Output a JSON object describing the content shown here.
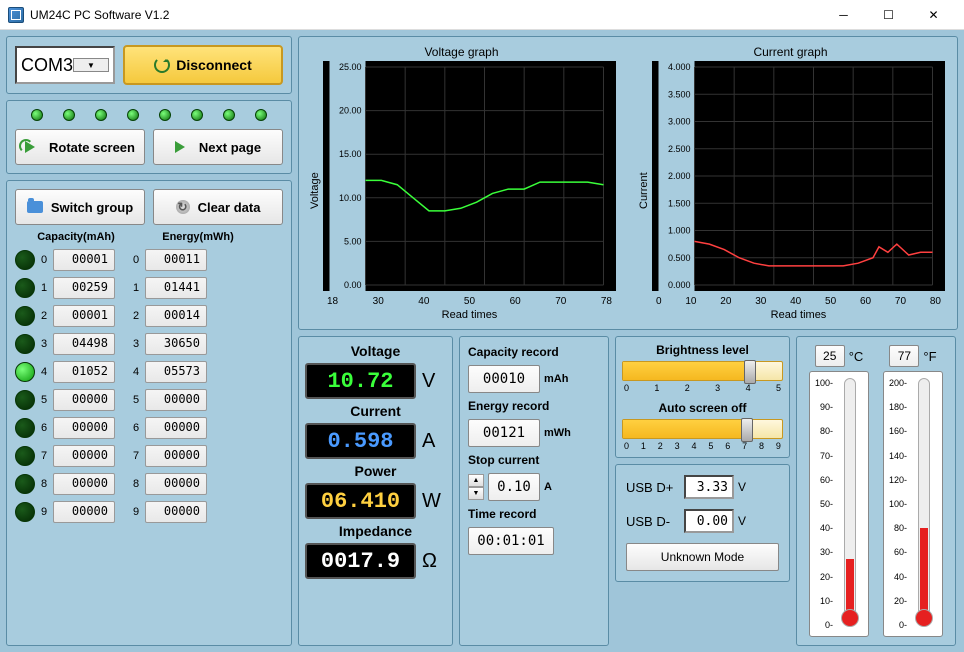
{
  "window": {
    "title": "UM24C PC Software V1.2"
  },
  "connection": {
    "port": "COM3",
    "button": "Disconnect"
  },
  "nav": {
    "rotate": "Rotate screen",
    "next": "Next page",
    "switch": "Switch group",
    "clear": "Clear data"
  },
  "groups": {
    "cap_header": "Capacity(mAh)",
    "en_header": "Energy(mWh)",
    "rows": [
      {
        "i": "0",
        "cap": "00001",
        "en": "00011",
        "on": false
      },
      {
        "i": "1",
        "cap": "00259",
        "en": "01441",
        "on": false
      },
      {
        "i": "2",
        "cap": "00001",
        "en": "00014",
        "on": false
      },
      {
        "i": "3",
        "cap": "04498",
        "en": "30650",
        "on": false
      },
      {
        "i": "4",
        "cap": "01052",
        "en": "05573",
        "on": true
      },
      {
        "i": "5",
        "cap": "00000",
        "en": "00000",
        "on": false
      },
      {
        "i": "6",
        "cap": "00000",
        "en": "00000",
        "on": false
      },
      {
        "i": "7",
        "cap": "00000",
        "en": "00000",
        "on": false
      },
      {
        "i": "8",
        "cap": "00000",
        "en": "00000",
        "on": false
      },
      {
        "i": "9",
        "cap": "00000",
        "en": "00000",
        "on": false
      }
    ]
  },
  "chart_data": [
    {
      "type": "line",
      "title": "Voltage graph",
      "ylabel": "Voltage",
      "xlabel": "Read times",
      "ylim": [
        0,
        25
      ],
      "yticks": [
        "25.00",
        "20.00",
        "15.00",
        "10.00",
        "5.00",
        "0.00"
      ],
      "xlim": [
        18,
        78
      ],
      "xticks": [
        "18",
        "30",
        "40",
        "50",
        "60",
        "70",
        "78"
      ],
      "color": "#3aff3a",
      "x": [
        18,
        22,
        26,
        30,
        34,
        38,
        42,
        46,
        50,
        54,
        58,
        62,
        66,
        70,
        74,
        78
      ],
      "y": [
        12.0,
        12.0,
        11.5,
        10.0,
        8.5,
        8.5,
        8.8,
        9.5,
        10.5,
        11.0,
        11.0,
        11.8,
        11.8,
        11.8,
        11.8,
        11.5
      ]
    },
    {
      "type": "line",
      "title": "Current graph",
      "ylabel": "Current",
      "xlabel": "Read times",
      "ylim": [
        0,
        4
      ],
      "yticks": [
        "4.000",
        "3.500",
        "3.000",
        "2.500",
        "2.000",
        "1.500",
        "1.000",
        "0.500",
        "0.000"
      ],
      "xlim": [
        0,
        80
      ],
      "xticks": [
        "0",
        "10",
        "20",
        "30",
        "40",
        "50",
        "60",
        "70",
        "80"
      ],
      "color": "#ff4040",
      "x": [
        0,
        5,
        10,
        15,
        20,
        25,
        30,
        35,
        40,
        45,
        50,
        55,
        60,
        62,
        65,
        68,
        72,
        76,
        80
      ],
      "y": [
        0.8,
        0.75,
        0.65,
        0.5,
        0.4,
        0.35,
        0.35,
        0.35,
        0.35,
        0.35,
        0.35,
        0.4,
        0.5,
        0.7,
        0.6,
        0.75,
        0.55,
        0.6,
        0.6
      ]
    }
  ],
  "readouts": {
    "voltage": {
      "label": "Voltage",
      "val": "10.72",
      "unit": "V"
    },
    "current": {
      "label": "Current",
      "val": "0.598",
      "unit": "A"
    },
    "power": {
      "label": "Power",
      "val": "06.410",
      "unit": "W"
    },
    "impedance": {
      "label": "Impedance",
      "val": "0017.9",
      "unit": "Ω"
    }
  },
  "records": {
    "cap": {
      "label": "Capacity record",
      "val": "00010",
      "unit": "mAh"
    },
    "en": {
      "label": "Energy record",
      "val": "00121",
      "unit": "mWh"
    },
    "stop": {
      "label": "Stop current",
      "val": "0.10",
      "unit": "A"
    },
    "time": {
      "label": "Time record",
      "val": "00:01:01"
    }
  },
  "sliders": {
    "brightness": {
      "label": "Brightness level",
      "ticks": [
        "0",
        "1",
        "2",
        "3",
        "4",
        "5"
      ],
      "pos": 4,
      "max": 5
    },
    "screenoff": {
      "label": "Auto screen off",
      "ticks": [
        "0",
        "1",
        "2",
        "3",
        "4",
        "5",
        "6",
        "7",
        "8",
        "9"
      ],
      "pos": 7,
      "max": 9
    }
  },
  "usb": {
    "dplus": {
      "label": "USB D+",
      "val": "3.33",
      "unit": "V"
    },
    "dminus": {
      "label": "USB D-",
      "val": "0.00",
      "unit": "V"
    },
    "mode": "Unknown Mode"
  },
  "temp": {
    "c": {
      "val": "25",
      "unit": "°C",
      "scale": [
        "100",
        "90",
        "80",
        "70",
        "60",
        "50",
        "40",
        "30",
        "20",
        "10",
        "0"
      ],
      "fill": 25
    },
    "f": {
      "val": "77",
      "unit": "°F",
      "scale": [
        "200",
        "180",
        "160",
        "140",
        "120",
        "100",
        "80",
        "60",
        "40",
        "20",
        "0"
      ],
      "fill": 38
    }
  }
}
